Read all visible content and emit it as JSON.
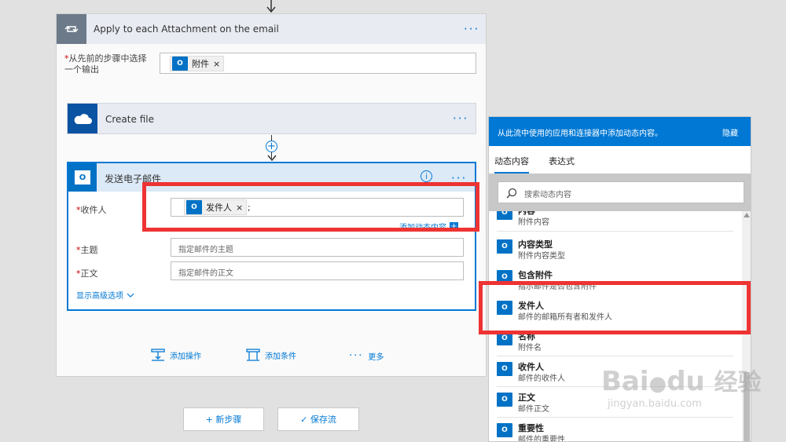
{
  "loop": {
    "title": "Apply to each Attachment on the email",
    "menu": "···",
    "select_label": "从先前的步骤中选择一个输出",
    "token": "附件",
    "token_remove": "×"
  },
  "create_file": {
    "title": "Create file",
    "menu": "···"
  },
  "send_email": {
    "title": "发送电子邮件",
    "info": "i",
    "menu": "···",
    "to_label": "收件人",
    "to_token": "发件人",
    "to_token_remove": "×",
    "to_suffix": ";",
    "add_dynamic": "添加动态内容",
    "add_dynamic_plus": "+",
    "subject_label": "主题",
    "subject_placeholder": "指定邮件的主题",
    "body_label": "正文",
    "body_placeholder": "指定邮件的正文",
    "advanced": "显示高级选项",
    "required_mark": "*"
  },
  "actions": {
    "add_action": "添加操作",
    "add_condition": "添加条件",
    "more": "更多",
    "more_dots": "···"
  },
  "bottom": {
    "new_step": "+ 新步骤",
    "save_flow": "✓ 保存流"
  },
  "dynamic_panel": {
    "header": "从此流中使用的应用和连接器中添加动态内容。",
    "hide": "隐藏",
    "tabs": [
      "动态内容",
      "表达式"
    ],
    "search_placeholder": "搜索动态内容",
    "items": [
      {
        "title": "内容",
        "desc": "附件内容"
      },
      {
        "title": "内容类型",
        "desc": "附件内容类型"
      },
      {
        "title": "包含附件",
        "desc": "指示邮件是否包含附件"
      },
      {
        "title": "发件人",
        "desc": "邮件的邮箱所有者和发件人"
      },
      {
        "title": "名称",
        "desc": "附件名"
      },
      {
        "title": "收件人",
        "desc": "邮件的收件人"
      },
      {
        "title": "正文",
        "desc": "邮件正文"
      },
      {
        "title": "重要性",
        "desc": "邮件的重要性"
      }
    ]
  },
  "watermark": {
    "brand": "Bai",
    "brand2": "du",
    "cn": "经验",
    "url": "jingyan.baidu.com"
  },
  "colors": {
    "accent": "#0078d4",
    "outlook": "#0072c6",
    "highlight": "#ee3333",
    "panel_header": "#0078d4"
  }
}
